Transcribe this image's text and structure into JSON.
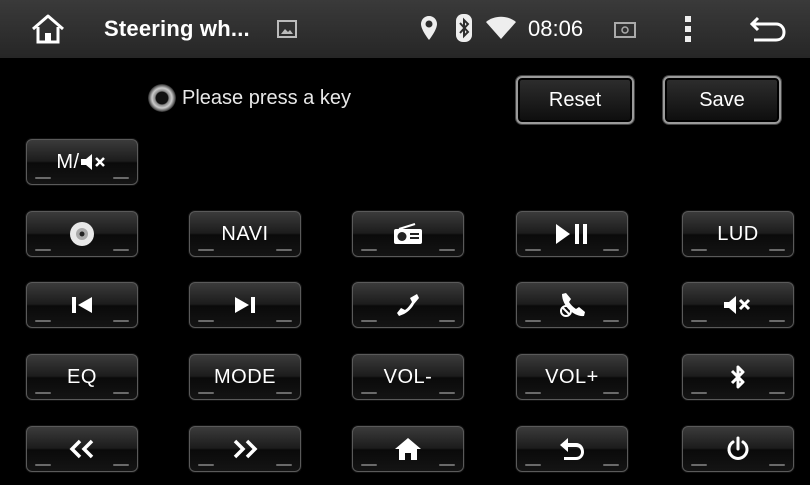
{
  "status_bar": {
    "title": "Steering wh...",
    "time": "08:06",
    "icons": [
      "home-icon",
      "image-icon",
      "location-icon",
      "bluetooth-icon",
      "wifi-icon",
      "screenshot-icon",
      "overflow-menu-icon",
      "back-icon"
    ]
  },
  "prompt": {
    "text": "Please press a key"
  },
  "actions": {
    "reset_label": "Reset",
    "save_label": "Save"
  },
  "keys": {
    "mute_mode": "M/",
    "navi": "NAVI",
    "lud": "LUD",
    "eq": "EQ",
    "mode": "MODE",
    "vol_down": "VOL-",
    "vol_up": "VOL+"
  },
  "icon_keys": [
    "disc-icon",
    "radio-icon",
    "play-pause-icon",
    "previous-track-icon",
    "next-track-icon",
    "phone-answer-icon",
    "phone-hangup-icon",
    "mute-icon",
    "bluetooth-icon",
    "rewind-icon",
    "fast-forward-icon",
    "home-icon",
    "back-icon",
    "power-icon"
  ]
}
